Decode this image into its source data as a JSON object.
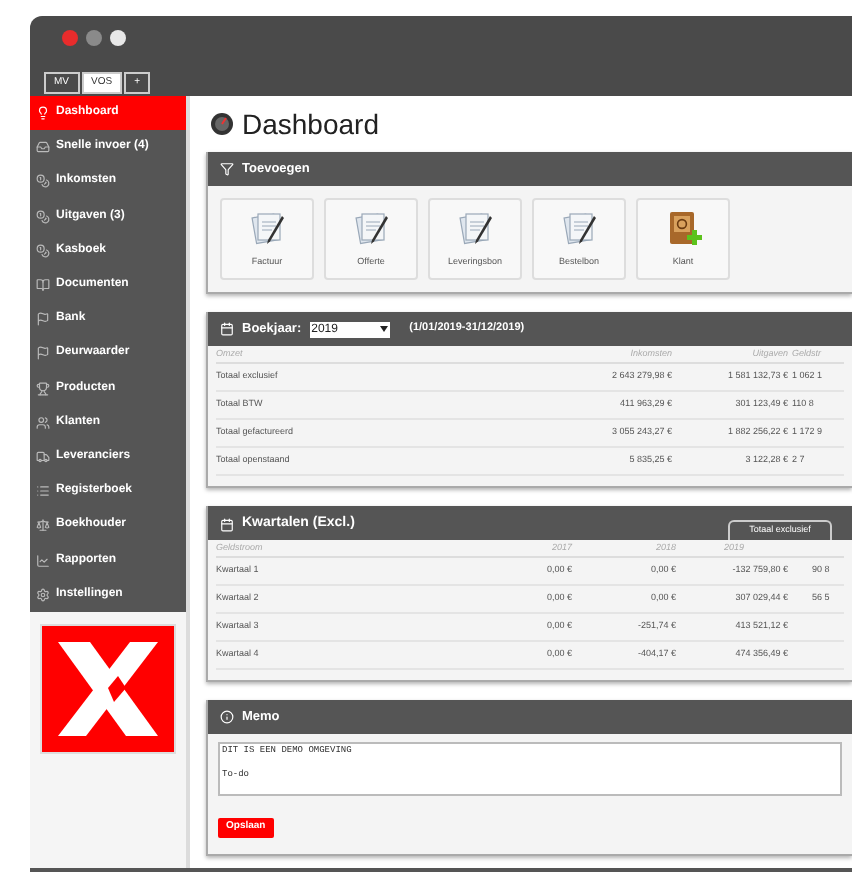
{
  "window": {
    "tabs": [
      {
        "label": "MV",
        "selected": false
      },
      {
        "label": "VOS",
        "selected": true
      },
      {
        "label": "+",
        "selected": false
      }
    ]
  },
  "sidebar": {
    "items": [
      {
        "label": "Dashboard",
        "selected": true
      },
      {
        "label": "Snelle invoer (4)",
        "selected": false
      },
      {
        "label": "Inkomsten",
        "selected": false
      },
      {
        "label": "Uitgaven (3)",
        "selected": false
      },
      {
        "label": "Kasboek",
        "selected": false
      },
      {
        "label": "Documenten",
        "selected": false
      },
      {
        "label": "Bank",
        "selected": false
      },
      {
        "label": "Deurwaarder",
        "selected": false
      },
      {
        "label": "Producten",
        "selected": false
      },
      {
        "label": "Klanten",
        "selected": false
      },
      {
        "label": "Leveranciers",
        "selected": false
      },
      {
        "label": "Registerboek",
        "selected": false
      },
      {
        "label": "Boekhouder",
        "selected": false
      },
      {
        "label": "Rapporten",
        "selected": false
      },
      {
        "label": "Instellingen",
        "selected": false
      }
    ]
  },
  "page": {
    "title": "Dashboard"
  },
  "add_panel": {
    "title": "Toevoegen",
    "items": [
      {
        "label": "Factuur",
        "kind": "document"
      },
      {
        "label": "Offerte",
        "kind": "document"
      },
      {
        "label": "Leveringsbon",
        "kind": "document"
      },
      {
        "label": "Bestelbon",
        "kind": "document"
      },
      {
        "label": "Klant",
        "kind": "contact"
      }
    ]
  },
  "year_panel": {
    "title": "Boekjaar:",
    "year": "2019",
    "range": "(1/01/2019-31/12/2019)",
    "columns": [
      "Omzet",
      "Inkomsten",
      "Uitgaven",
      "Geldstr"
    ],
    "rows": [
      [
        "Totaal exclusief",
        "2 643 279,98 €",
        "1 581 132,73 €",
        "1 062 1"
      ],
      [
        "Totaal BTW",
        "411 963,29 €",
        "301 123,49 €",
        "110 8"
      ],
      [
        "Totaal gefactureerd",
        "3 055 243,27 €",
        "1 882 256,22 €",
        "1 172 9"
      ],
      [
        "Totaal openstaand",
        "5 835,25 €",
        "3 122,28 €",
        "2 7"
      ]
    ]
  },
  "quarter_panel": {
    "title": "Kwartalen (Excl.)",
    "toggle": "Totaal exclusief",
    "columns": [
      "Geldstroom",
      "2017",
      "2018",
      "2019"
    ],
    "rows": [
      [
        "Kwartaal 1",
        "0,00 €",
        "0,00 €",
        "-132 759,80 €",
        "90 8"
      ],
      [
        "Kwartaal 2",
        "0,00 €",
        "0,00 €",
        "307 029,44 €",
        "56 5"
      ],
      [
        "Kwartaal 3",
        "0,00 €",
        "-251,74 €",
        "413 521,12 €"
      ],
      [
        "Kwartaal 4",
        "0,00 €",
        "-404,17 €",
        "474 356,49 €"
      ]
    ]
  },
  "memo": {
    "title": "Memo",
    "value": "DIT IS EEN DEMO OMGEVING\n\nTo-do",
    "button": "Opslaan"
  }
}
